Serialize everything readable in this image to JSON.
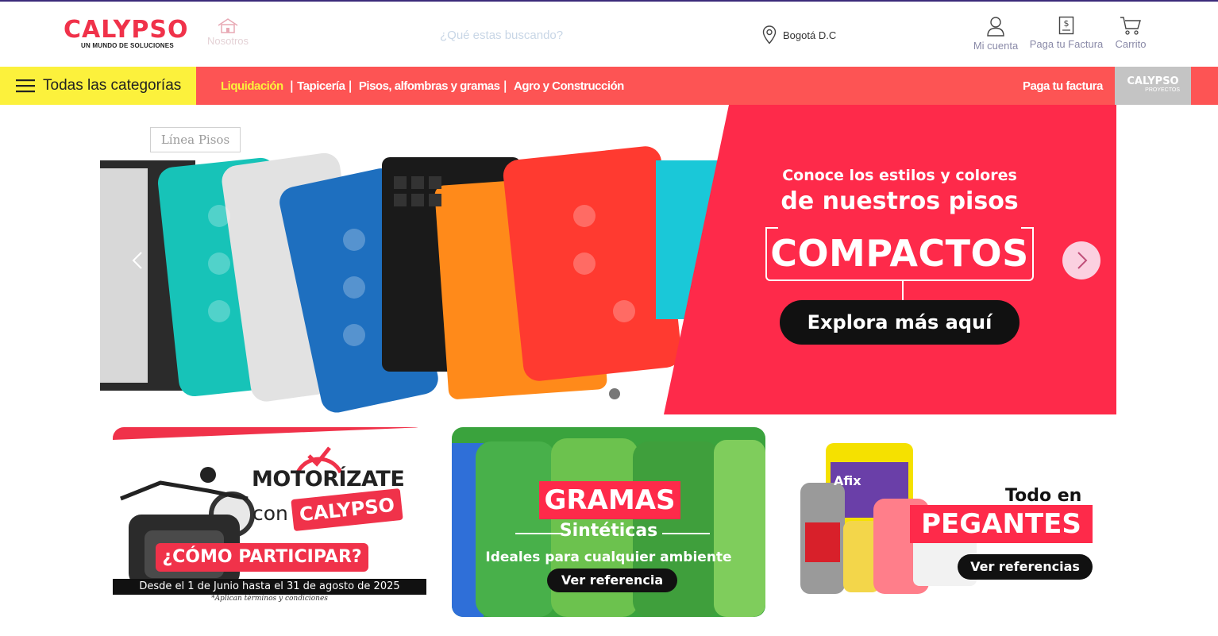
{
  "header": {
    "logo_main": "CALYPSO",
    "logo_sub": "UN MUNDO DE SOLUCIONES",
    "nosotros_label": "Nosotros",
    "search_placeholder": "¿Qué estas buscando?",
    "location_label": "Bogotá D.C",
    "actions": {
      "cuenta": "Mi cuenta",
      "factura": "Paga tu Factura",
      "carrito": "Carrito"
    }
  },
  "navbar": {
    "all_categories_label": "Todas las categorías",
    "links": [
      "Liquidación",
      "Tapicería",
      "Pisos, alfombras y gramas",
      "Agro y Construcción"
    ],
    "separator": "|",
    "pay_label": "Paga tu factura",
    "proyectos_main": "CALYPSO",
    "proyectos_sub": "PROYECTOS"
  },
  "hero": {
    "tag": "Línea Pisos",
    "line1": "Conoce los estilos y colores",
    "line2": "de nuestros pisos",
    "big": "COMPACTOS",
    "cta": "Explora más aquí"
  },
  "cards": {
    "motor": {
      "title": "MOTORÍZATE",
      "con": "con",
      "brand": "CALYPSO",
      "how": "¿CÓMO PARTICIPAR?",
      "dates": "Desde el 1 de Junio hasta el 31 de agosto de 2025",
      "terms": "*Aplican términos y condiciones"
    },
    "gramas": {
      "title": "GRAMAS",
      "sub": "Sintéticas",
      "desc": "Ideales para cualquier ambiente",
      "cta": "Ver referencia"
    },
    "pegantes": {
      "todo": "Todo en",
      "title": "PEGANTES",
      "cta": "Ver referencias",
      "brand": "Afix"
    }
  },
  "colors": {
    "brand_red": "#f0324a",
    "nav_red": "#fd5454",
    "nav_yellow": "#fcf13c",
    "hero_red": "#fe2a4a"
  },
  "icons": [
    "house-icon",
    "location-pin-icon",
    "user-icon",
    "invoice-icon",
    "cart-icon",
    "hamburger-icon",
    "chevron-left-icon",
    "chevron-right-icon"
  ]
}
